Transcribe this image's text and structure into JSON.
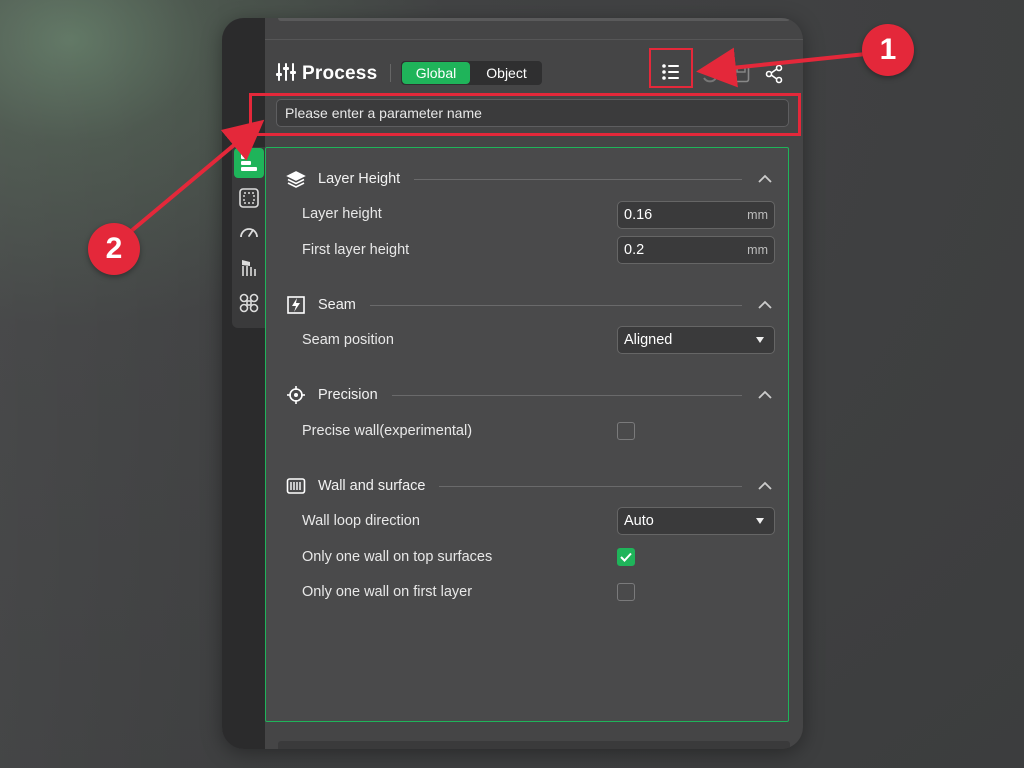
{
  "panel": {
    "title": "Process",
    "segment": {
      "active": "Global",
      "inactive": "Object"
    }
  },
  "search": {
    "placeholder": "Please enter a parameter name"
  },
  "sections": {
    "layer_height": {
      "title": "Layer Height",
      "rows": {
        "layer_height": {
          "label": "Layer height",
          "value": "0.16",
          "unit": "mm"
        },
        "first_layer_height": {
          "label": "First layer height",
          "value": "0.2",
          "unit": "mm"
        }
      }
    },
    "seam": {
      "title": "Seam",
      "rows": {
        "seam_position": {
          "label": "Seam position",
          "value": "Aligned"
        }
      }
    },
    "precision": {
      "title": "Precision",
      "rows": {
        "precise_wall": {
          "label": "Precise wall(experimental)",
          "checked": false
        }
      }
    },
    "wall_surface": {
      "title": "Wall and surface",
      "rows": {
        "wall_loop_direction": {
          "label": "Wall loop direction",
          "value": "Auto"
        },
        "one_wall_top": {
          "label": "Only one wall on top surfaces",
          "checked": true
        },
        "one_wall_first": {
          "label": "Only one wall on first layer",
          "checked": false
        }
      }
    }
  },
  "callouts": {
    "one": "1",
    "two": "2"
  },
  "colors": {
    "accent": "#1fb45a",
    "annotation": "#e4283a"
  }
}
